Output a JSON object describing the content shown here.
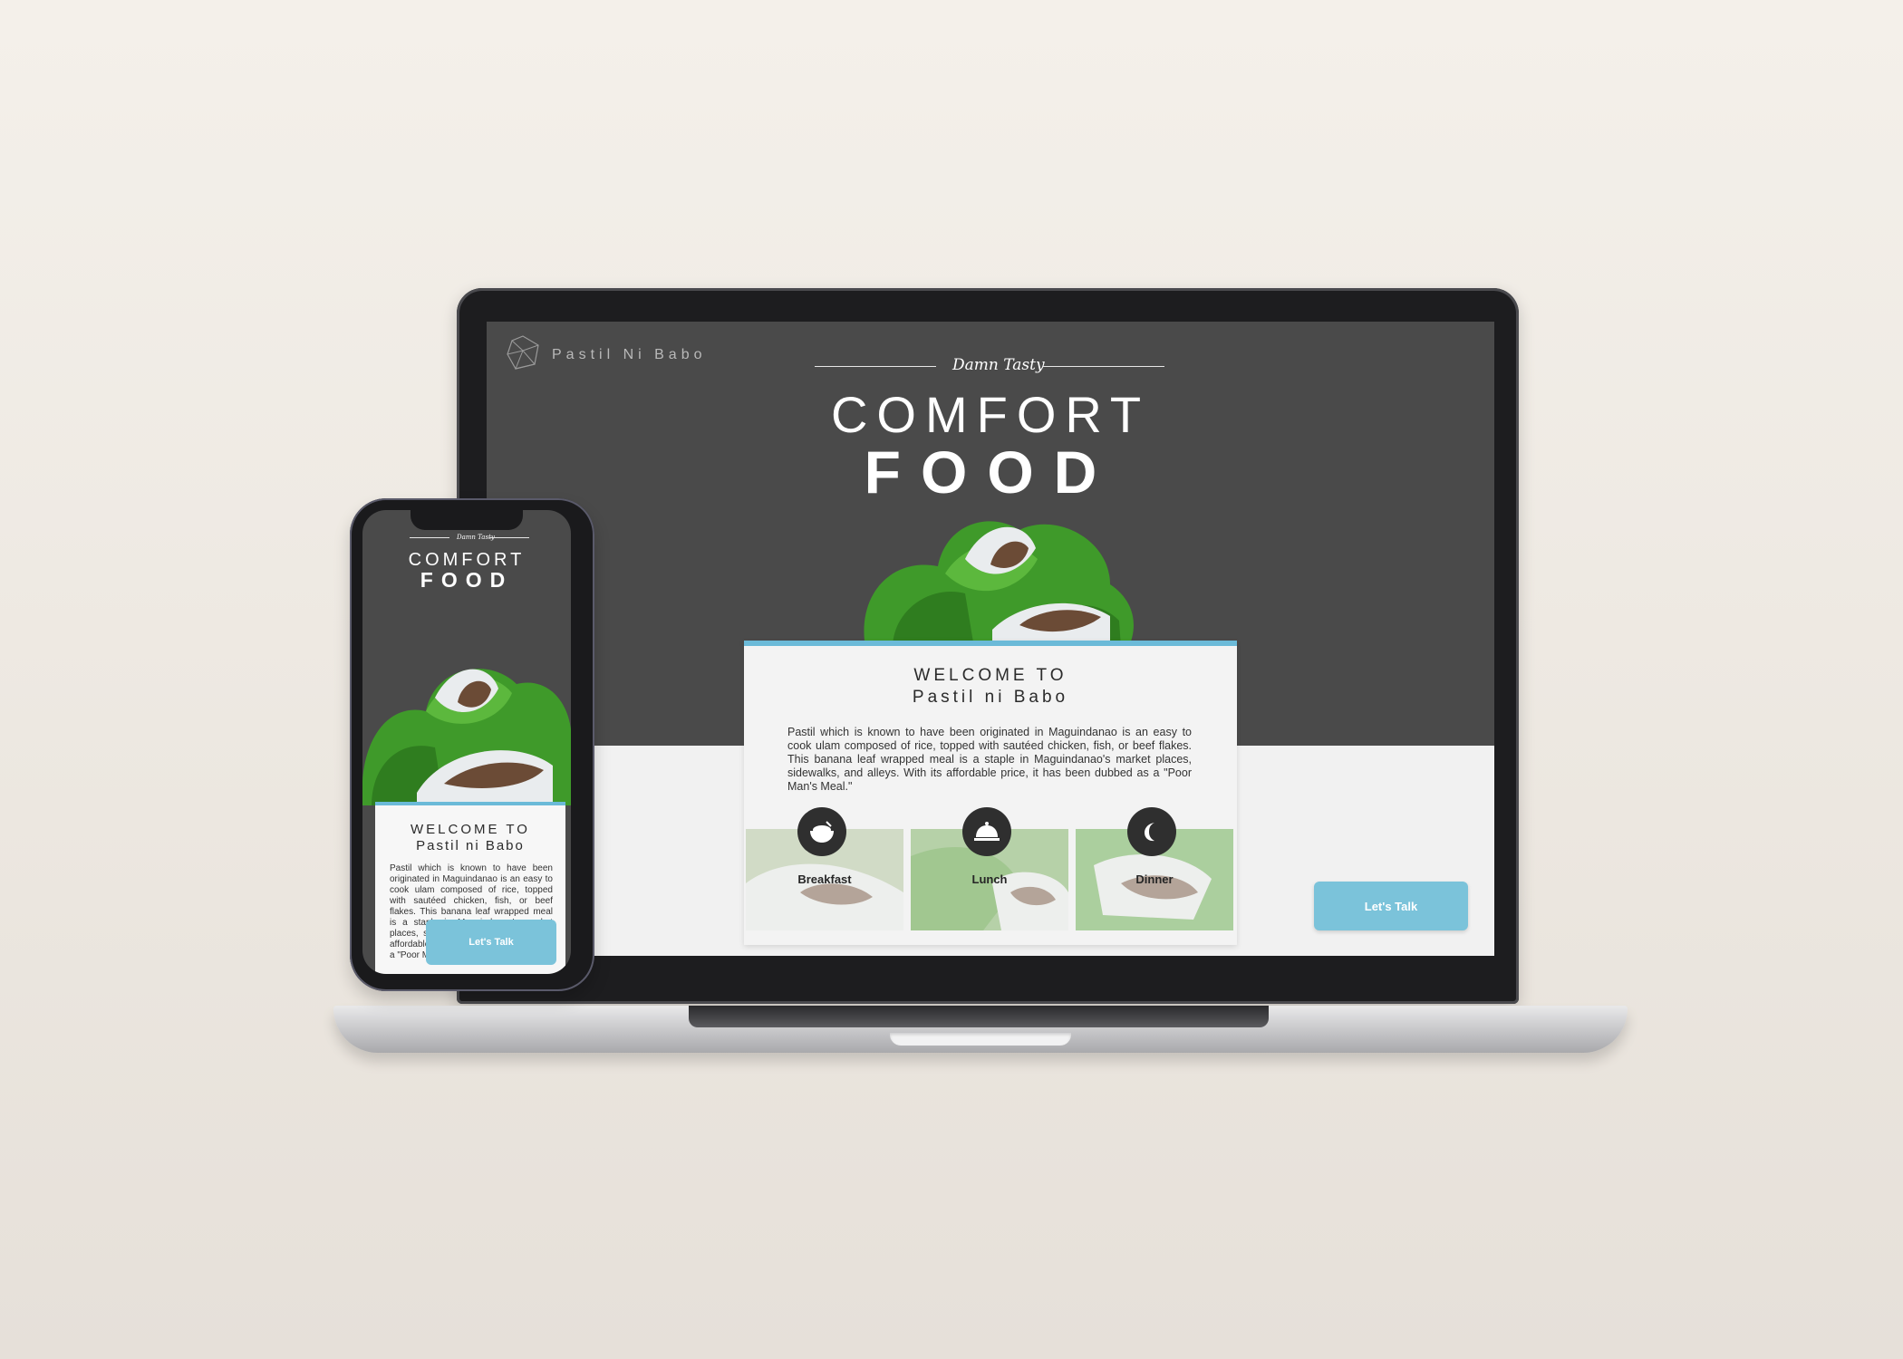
{
  "site": {
    "brand": "Pastil Ni Babo",
    "tagline": "Damn Tasty",
    "hero_line1": "COMFORT",
    "hero_line2": "FOOD",
    "welcome_line1": "WELCOME TO",
    "welcome_line2": "Pastil ni Babo",
    "description": "Pastil which is known to have been originated in Maguindanao is an easy to cook ulam composed of rice, topped with sautéed chicken, fish, or beef flakes. This banana leaf wrapped meal is a staple in Maguindanao's market places, sidewalks, and alleys. With its affordable price, it has been dubbed as a \"Poor Man's Meal.\"",
    "meals": [
      {
        "label": "Breakfast",
        "icon": "rice-bowl-icon"
      },
      {
        "label": "Lunch",
        "icon": "cloche-icon"
      },
      {
        "label": "Dinner",
        "icon": "moon-icon"
      }
    ],
    "cta_label": "Let's Talk"
  },
  "mobile": {
    "tagline": "Damn Tasty",
    "hero_line1": "COMFORT",
    "hero_line2": "FOOD",
    "welcome_line1": "WELCOME TO",
    "welcome_line2": "Pastil ni Babo",
    "description": "Pastil which is known to have been originated in Maguindanao is an easy to cook ulam composed of rice, topped with sautéed chicken, fish, or beef flakes. This banana leaf wrapped meal is a staple in Maguindanao's market places, sidewalks, and alleys. With its affordable price, it has been dubbed as a \"Poor Man's Meal.\"",
    "cta_label": "Let's Talk"
  },
  "colors": {
    "accent": "#7bc3da",
    "hero_bg": "#4a4a4a",
    "content_bg": "#f1f1f1",
    "leaf_green": "#3f9a2a"
  }
}
